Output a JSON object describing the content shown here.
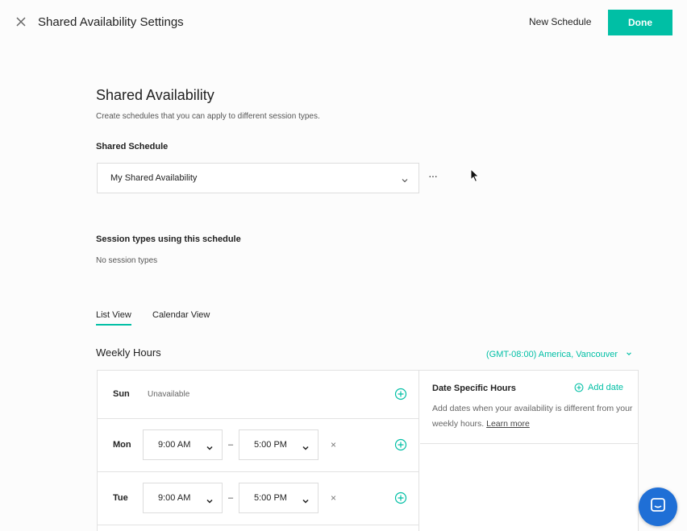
{
  "header": {
    "title": "Shared Availability Settings",
    "new_schedule_label": "New Schedule",
    "done_label": "Done"
  },
  "section": {
    "title": "Shared Availability",
    "description": "Create schedules that you can apply to different session types."
  },
  "shared_schedule": {
    "label": "Shared Schedule",
    "selected": "My Shared Availability",
    "more_label": "···"
  },
  "session_types": {
    "label": "Session types using this schedule",
    "value": "No session types"
  },
  "tabs": [
    {
      "label": "List View",
      "active": true
    },
    {
      "label": "Calendar View",
      "active": false
    }
  ],
  "weekly": {
    "title": "Weekly Hours",
    "timezone": "(GMT-08:00) America, Vancouver",
    "days": [
      {
        "name": "Sun",
        "status": "Unavailable"
      },
      {
        "name": "Mon",
        "start": "9:00 AM",
        "end": "5:00 PM"
      },
      {
        "name": "Tue",
        "start": "9:00 AM",
        "end": "5:00 PM"
      }
    ],
    "dash": "–",
    "remove": "×"
  },
  "date_specific": {
    "title": "Date Specific Hours",
    "add_label": "Add date",
    "description": "Add dates when your availability is different from your weekly hours.",
    "learn_more": "Learn more"
  },
  "colors": {
    "accent": "#00bfa5",
    "chat": "#1f6fd6"
  },
  "icons": [
    "close-icon",
    "chevron-down-icon",
    "add-circle-icon",
    "remove-icon",
    "chat-icon",
    "cursor-icon"
  ]
}
